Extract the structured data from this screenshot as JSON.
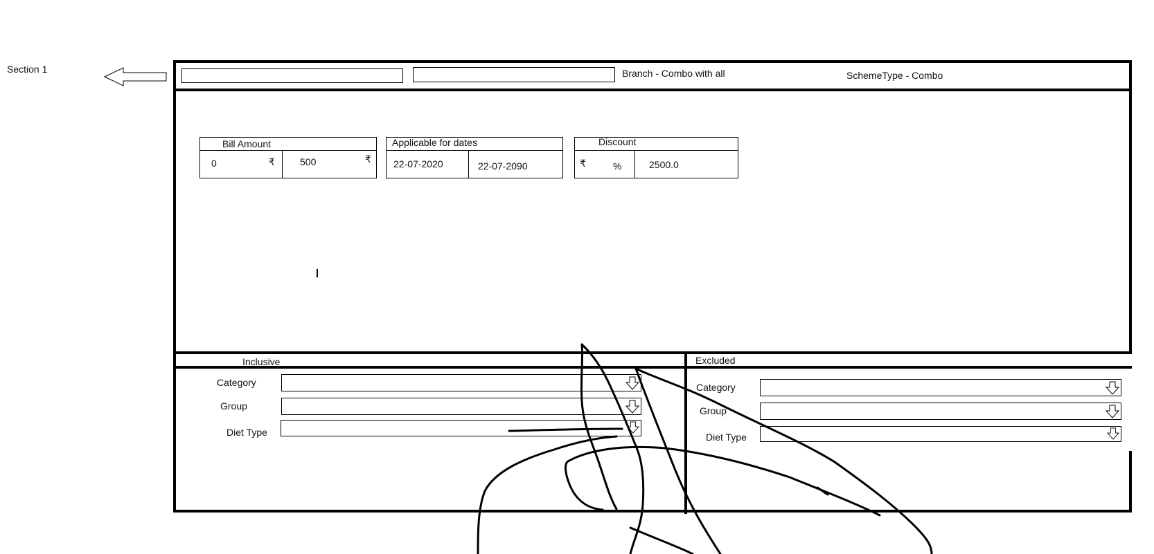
{
  "annotation": {
    "section_label": "Section 1"
  },
  "header": {
    "field1_value": "",
    "field2_value": "",
    "branch_label": "Branch - Combo with all",
    "scheme_type_label": "SchemeType - Combo"
  },
  "bill_amount": {
    "title": "Bill Amount",
    "from": "0",
    "to": "500",
    "currency_symbol": "₹"
  },
  "dates": {
    "title": "Applicable for dates",
    "from": "22-07-2020",
    "to": "22-07-2090"
  },
  "discount": {
    "title": "Discount",
    "currency_symbol": "₹",
    "percent_symbol": "%",
    "value": "2500.0"
  },
  "inclusive": {
    "title": "Inclusive",
    "fields": [
      {
        "label": "Category",
        "value": ""
      },
      {
        "label": "Group",
        "value": ""
      },
      {
        "label": "Diet Type",
        "value": ""
      }
    ]
  },
  "excluded": {
    "title": "Excluded",
    "fields": [
      {
        "label": "Category",
        "value": ""
      },
      {
        "label": "Group",
        "value": ""
      },
      {
        "label": "Diet Type",
        "value": ""
      }
    ]
  }
}
